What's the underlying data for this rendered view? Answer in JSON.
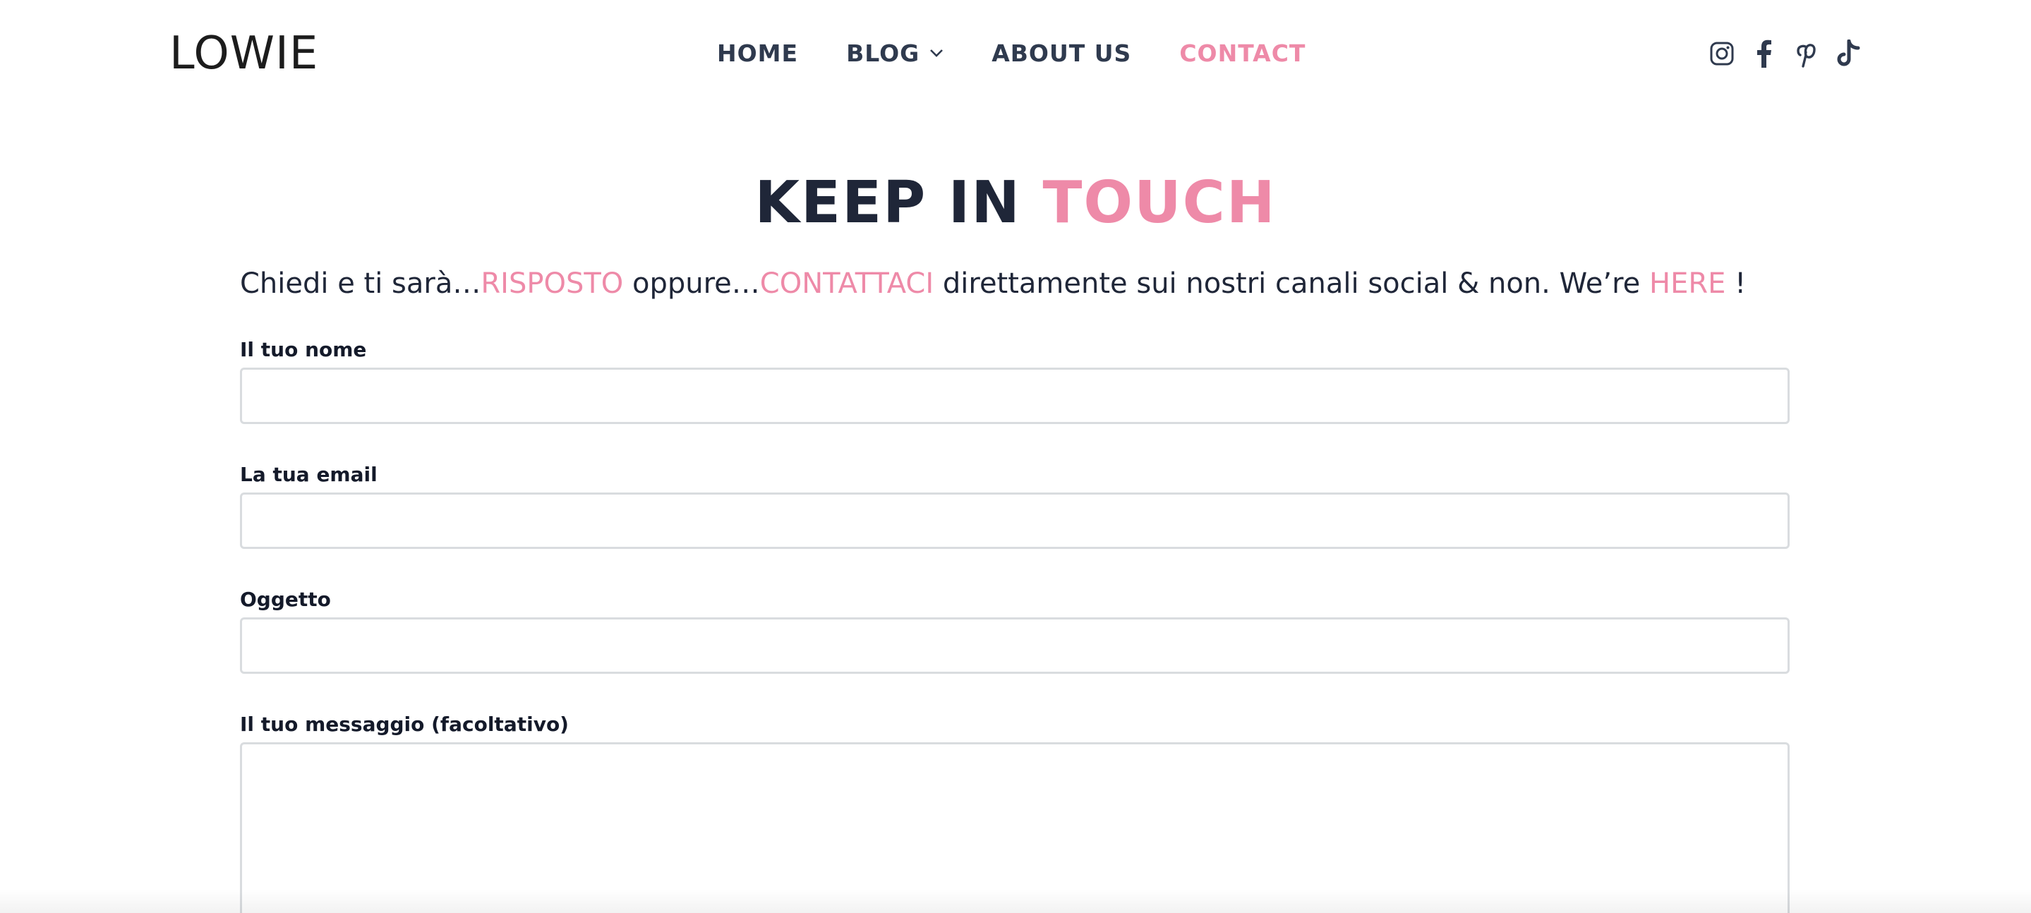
{
  "header": {
    "logo": "LOWIE",
    "nav": [
      {
        "label": "HOME"
      },
      {
        "label": "BLOG"
      },
      {
        "label": "ABOUT US"
      },
      {
        "label": "CONTACT"
      }
    ],
    "social_icons": [
      "instagram-icon",
      "facebook-icon",
      "pinterest-icon",
      "tiktok-icon"
    ]
  },
  "main": {
    "title_part1": "KEEP IN",
    "title_part2": "TOUCH",
    "intro": {
      "t1": "Chiedi e ti sarà…",
      "p1": "RISPOSTO",
      "t2": " oppure…",
      "p2": "CONTATTACI",
      "t3": " direttamente sui nostri canali social & non. We’re ",
      "p3": "HERE",
      "t4": " !"
    },
    "form": {
      "name_label": "Il tuo nome",
      "email_label": "La tua email",
      "subject_label": "Oggetto",
      "message_label": "Il tuo messaggio (facoltativo)"
    }
  },
  "colors": {
    "accent": "#ee8aa8",
    "text_dark": "#1f2638",
    "nav_text": "#2f3a4e",
    "input_border": "#d9dcdf"
  }
}
